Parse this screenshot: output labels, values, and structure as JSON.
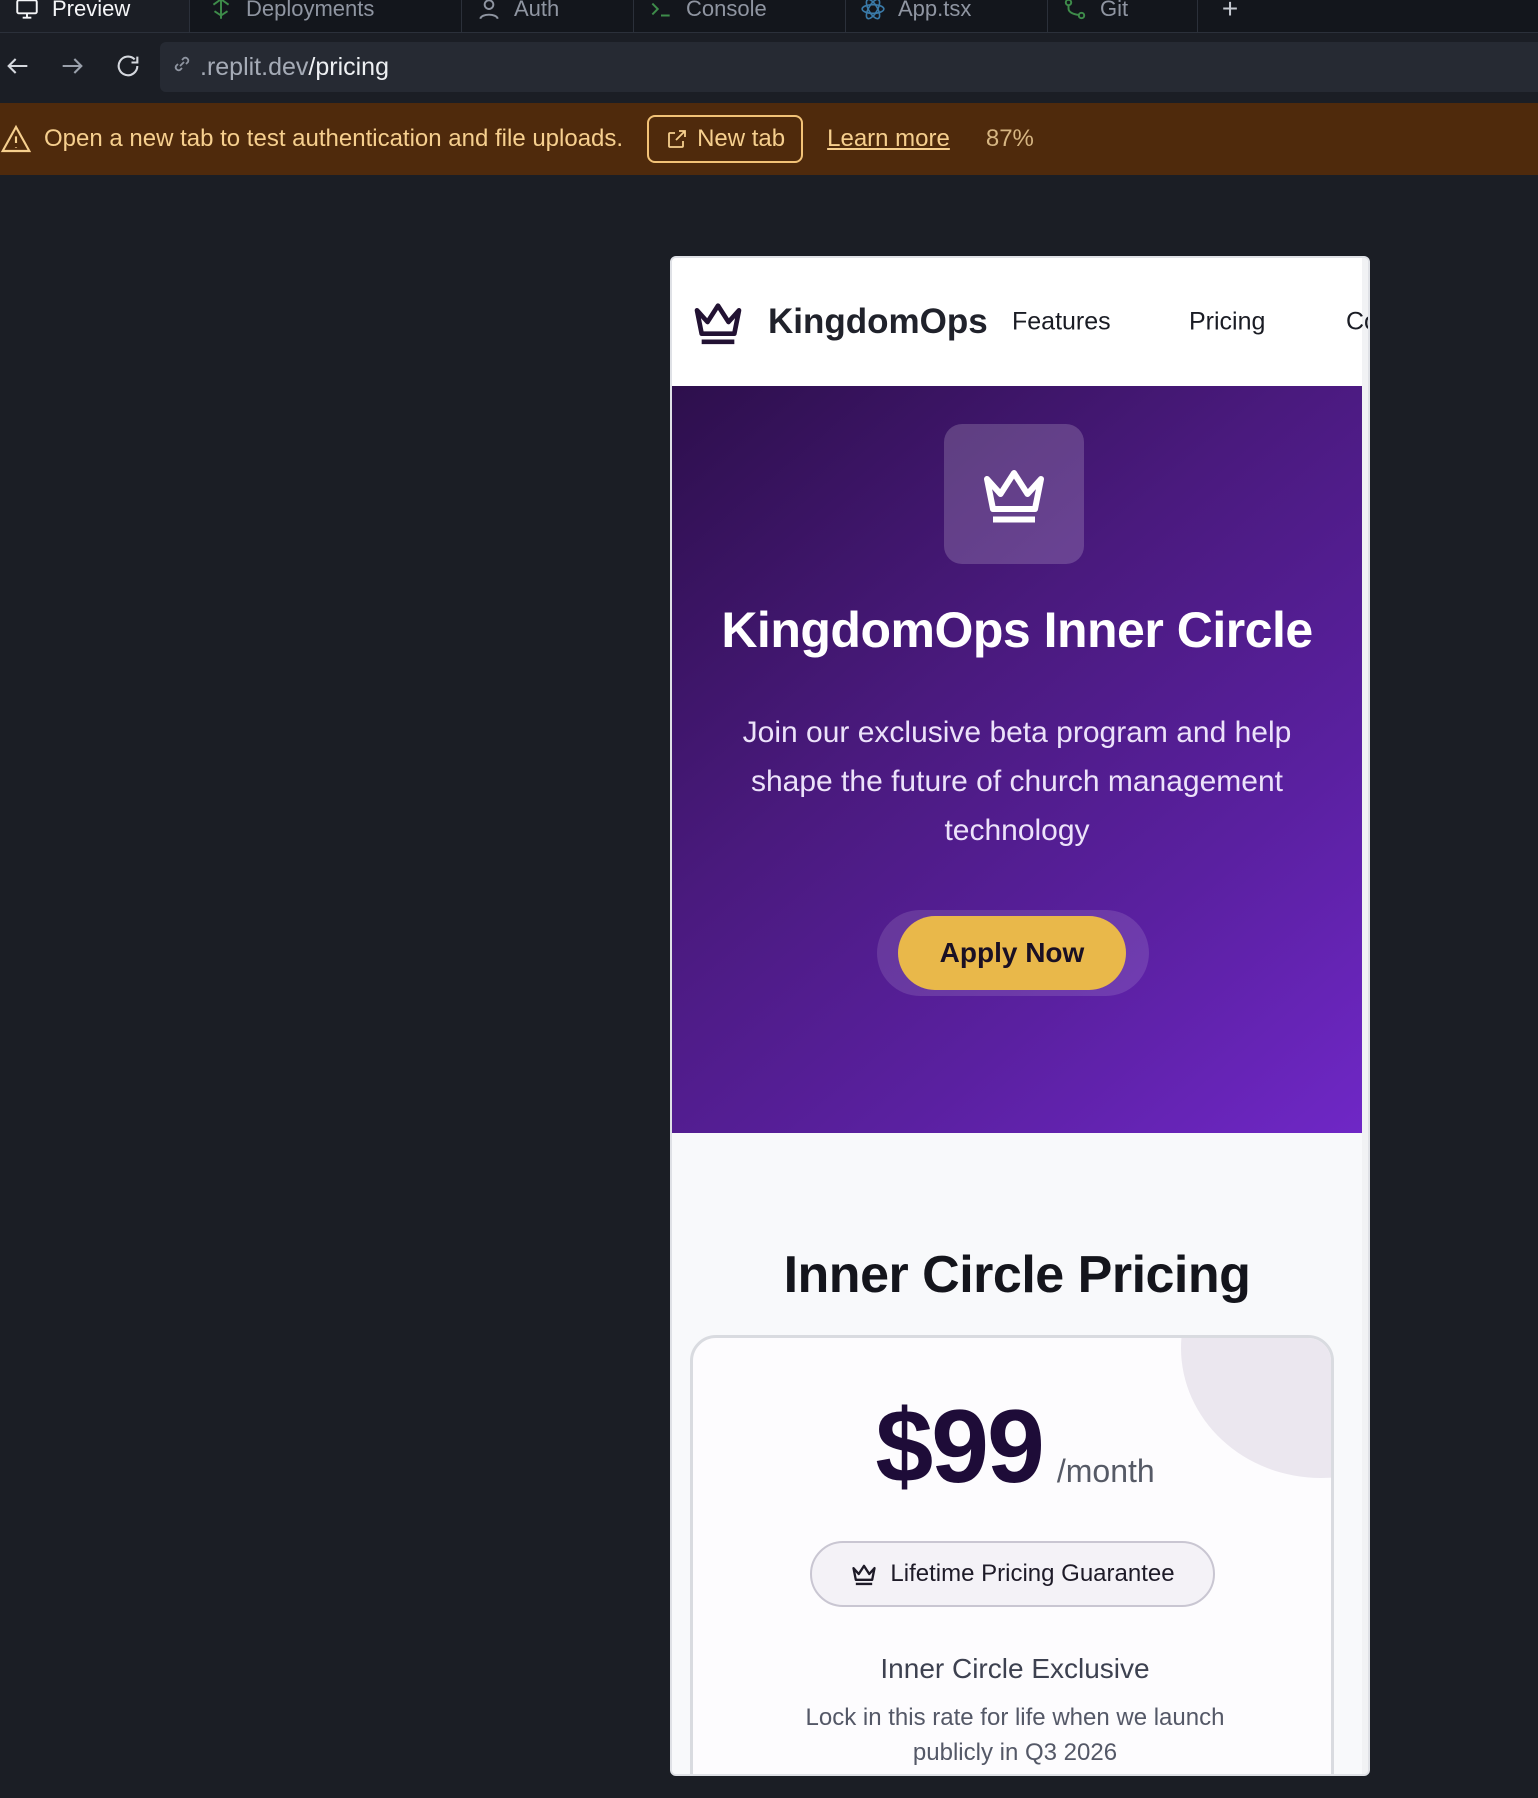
{
  "ide": {
    "tabs": [
      {
        "label": "Preview",
        "icon": "monitor-icon"
      },
      {
        "label": "Deployments",
        "icon": "deploy-icon"
      },
      {
        "label": "Auth",
        "icon": "user-icon"
      },
      {
        "label": "Console",
        "icon": "terminal-icon"
      },
      {
        "label": "App.tsx",
        "icon": "react-icon"
      },
      {
        "label": "Git",
        "icon": "git-icon"
      }
    ],
    "add_tab": "+",
    "url": {
      "host": ".replit.dev",
      "path": "/pricing"
    }
  },
  "banner": {
    "message": "Open a new tab to test authentication and file uploads.",
    "new_tab_label": "New tab",
    "learn_more_label": "Learn more",
    "zoom": "87%"
  },
  "site": {
    "brand": "KingdomOps",
    "nav": [
      "Features",
      "Pricing",
      "Co"
    ],
    "hero": {
      "title": "KingdomOps Inner Circle",
      "subtitle": "Join our exclusive beta program and help shape the future of church management technology",
      "cta": "Apply Now"
    },
    "pricing": {
      "heading": "Inner Circle Pricing",
      "price": "$99",
      "period": "/month",
      "guarantee": "Lifetime Pricing Guarantee",
      "exclusive_title": "Inner Circle Exclusive",
      "exclusive_text": "Lock in this rate for life when we launch publicly in Q3 2026"
    }
  },
  "colors": {
    "banner_bg": "#4f2a0c",
    "hero_start": "#2d0f4c",
    "hero_end": "#6f27c6",
    "cta": "#e9b84a"
  }
}
